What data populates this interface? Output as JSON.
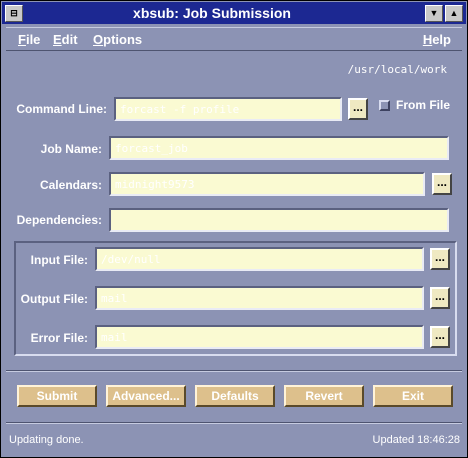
{
  "window": {
    "title": "xbsub: Job Submission"
  },
  "titlebar_buttons": {
    "menu": "⊟",
    "minimize": "▼",
    "maximize": "▲"
  },
  "menubar": {
    "file": {
      "first": "F",
      "rest": "ile"
    },
    "edit": {
      "first": "E",
      "rest": "dit"
    },
    "options": {
      "first": "O",
      "rest": "ptions"
    },
    "help": {
      "first": "H",
      "rest": "elp"
    }
  },
  "cwd": "/usr/local/work",
  "form": {
    "command_line": {
      "label": "Command Line:",
      "value": "forcast -f profile"
    },
    "from_file": {
      "label": "From File",
      "checked": false
    },
    "job_name": {
      "label": "Job Name:",
      "value": "forcast_job"
    },
    "calendars": {
      "label": "Calendars:",
      "value": "midnight9573"
    },
    "dependencies": {
      "label": "Dependencies:",
      "value": ""
    },
    "input_file": {
      "label": "Input File:",
      "value": "/dev/null"
    },
    "output_file": {
      "label": "Output File:",
      "value": "mail"
    },
    "error_file": {
      "label": "Error File:",
      "value": "mail"
    }
  },
  "browse_label": "...",
  "buttons": {
    "submit": "Submit",
    "advanced": "Advanced...",
    "defaults": "Defaults",
    "revert": "Revert",
    "exit": "Exit"
  },
  "status": {
    "message": "Updating done.",
    "updated": "Updated 18:46:28"
  }
}
